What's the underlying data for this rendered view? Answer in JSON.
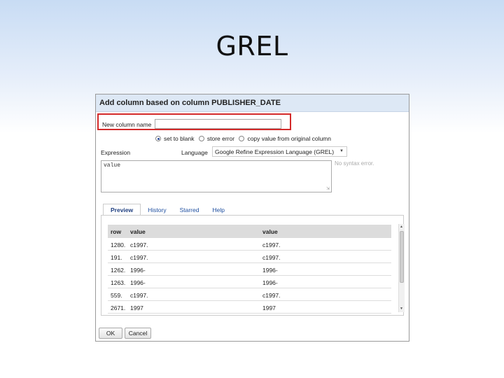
{
  "slide": {
    "title": "GREL"
  },
  "dialog": {
    "title": "Add column based on column PUBLISHER_DATE",
    "new_column_label": "New column name",
    "new_column_value": "",
    "on_error_options": [
      {
        "label": "set to blank",
        "selected": true
      },
      {
        "label": "store error",
        "selected": false
      },
      {
        "label": "copy value from original column",
        "selected": false
      }
    ],
    "expression_label": "Expression",
    "language_label": "Language",
    "language_value": "Google Refine Expression Language (GREL)",
    "expression_value": "value",
    "syntax_status": "No syntax error.",
    "tabs": [
      "Preview",
      "History",
      "Starred",
      "Help"
    ],
    "active_tab": "Preview",
    "preview": {
      "headers": [
        "row",
        "value",
        "value"
      ],
      "rows": [
        [
          "1280.",
          "c1997.",
          "c1997."
        ],
        [
          "191.",
          "c1997.",
          "c1997."
        ],
        [
          "1262.",
          "1996-",
          "1996-"
        ],
        [
          "1263.",
          "1996-",
          "1996-"
        ],
        [
          "559.",
          "c1997.",
          "c1997."
        ],
        [
          "2671.",
          "1997",
          "1997"
        ]
      ]
    },
    "ok_label": "OK",
    "cancel_label": "Cancel"
  },
  "colors": {
    "highlight_border": "#d32a2a",
    "header_bg": "#dde8f5",
    "link": "#1f4fa0"
  }
}
